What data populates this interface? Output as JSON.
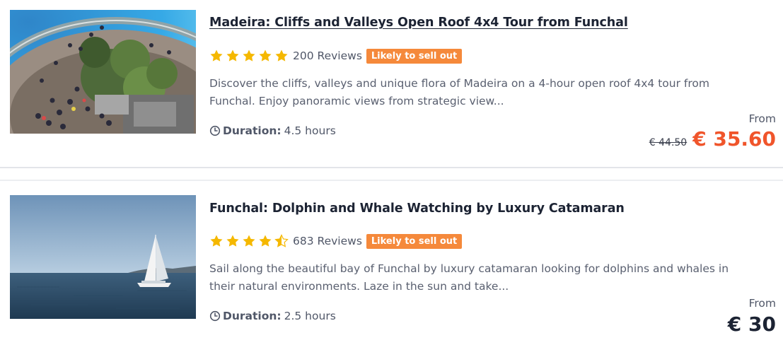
{
  "colors": {
    "star": "#f5b800",
    "badge": "#f5893b",
    "sale_price": "#f0552b"
  },
  "tours": [
    {
      "title": "Madeira: Cliffs and Valleys Open Roof 4x4 Tour from Funchal",
      "rating": 5,
      "reviews": "200 Reviews",
      "badge": "Likely to sell out",
      "description_line1": "Discover the cliffs, valleys and unique flora of Madeira on a 4-hour open roof 4x4 tour from",
      "description_line2": "Funchal. Enjoy panoramic views from strategic view...",
      "duration_icon": "clock-icon",
      "duration_label": "Duration:",
      "duration_value": "4.5 hours",
      "from_label": "From",
      "old_price": "€ 44.50",
      "price": "€ 35.60"
    },
    {
      "title": "Funchal: Dolphin and Whale Watching by Luxury Catamaran",
      "rating": 4.5,
      "reviews": "683 Reviews",
      "badge": "Likely to sell out",
      "description_line1": "Sail along the beautiful bay of Funchal by luxury catamaran looking for dolphins and whales in",
      "description_line2": "their natural environments. Laze in the sun and take...",
      "duration_icon": "clock-icon",
      "duration_label": "Duration:",
      "duration_value": "2.5 hours",
      "from_label": "From",
      "price": "€ 30"
    }
  ]
}
